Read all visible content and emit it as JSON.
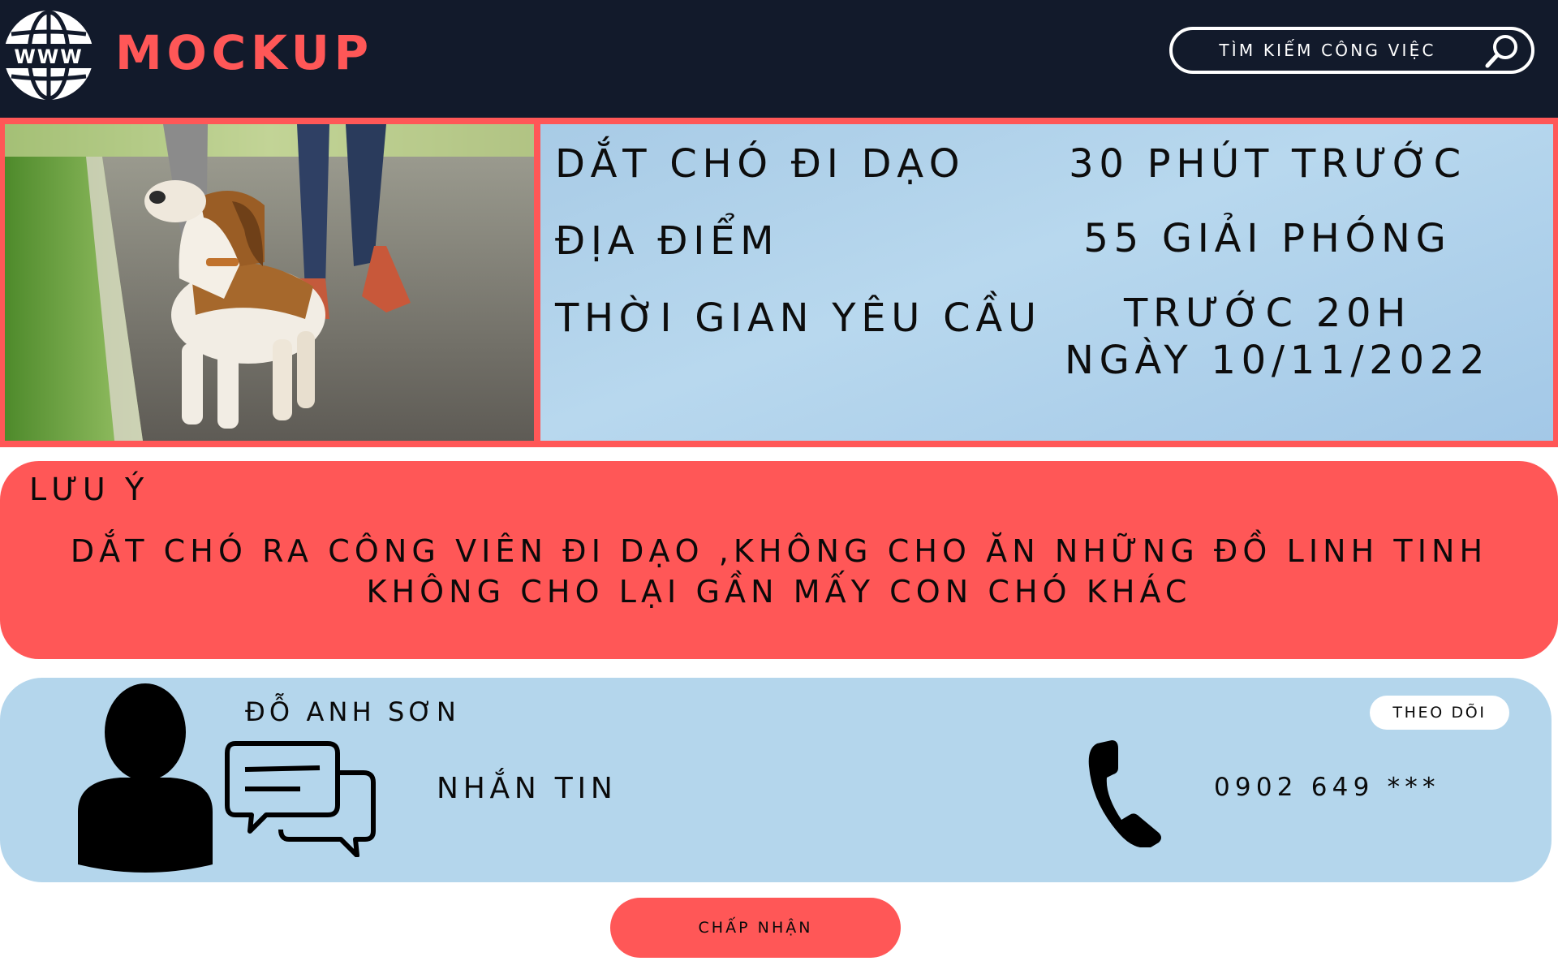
{
  "header": {
    "logo_text": "MOCKUP",
    "globe_label": "WWW",
    "search_placeholder": "TÌM KIẾM CÔNG VIỆC"
  },
  "job": {
    "title": "DẮT CHÓ ĐI DẠO",
    "posted": "30 PHÚT TRƯỚC",
    "location_label": "ĐỊA ĐIỂM",
    "location_value": "55 GIẢI PHÓNG",
    "time_label": "THỜI GIAN YÊU CẦU",
    "time_value_line1": "TRƯỚC 20H",
    "time_value_line2": "NGÀY 10/11/2022",
    "photo_icon": "dog-walking-photo"
  },
  "note": {
    "title": "LƯU Ý",
    "line1": "DẮT CHÓ RA CÔNG VIÊN ĐI DẠO ,KHÔNG CHO ĂN NHỮNG ĐỒ LINH TINH",
    "line2": "KHÔNG CHO LẠI GẦN MẤY CON CHÓ KHÁC"
  },
  "contact": {
    "name": "ĐỖ ANH SƠN",
    "message_label": "NHẮN TIN",
    "phone": "0902 649 ***",
    "follow_label": "THEO DÕI",
    "icons": [
      "user-avatar-icon",
      "chat-bubbles-icon",
      "phone-icon"
    ]
  },
  "actions": {
    "accept_label": "CHẤP NHẬN"
  },
  "colors": {
    "header_bg": "#121a2b",
    "accent": "#ff5757",
    "info_bg": "#b4d6ec",
    "white": "#ffffff"
  }
}
